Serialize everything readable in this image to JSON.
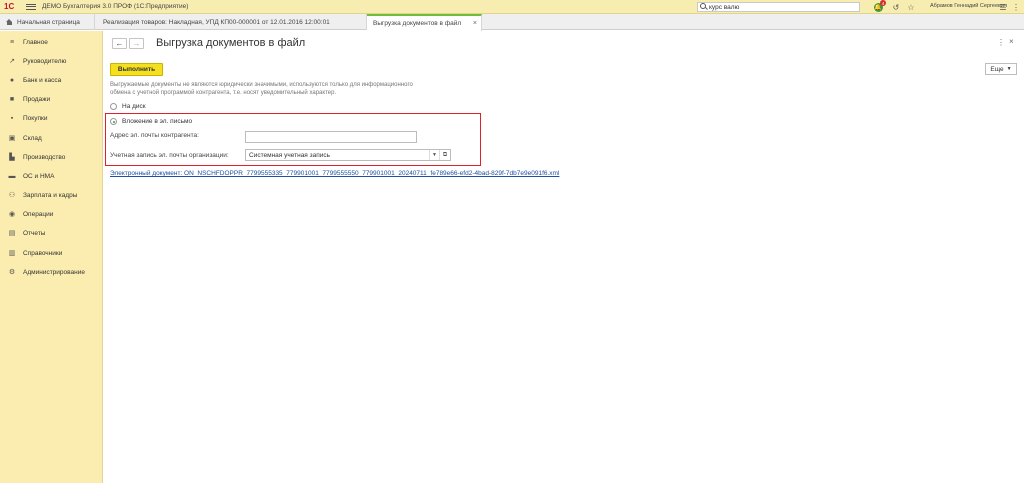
{
  "titlebar": {
    "logo": "1С",
    "app_title": "ДЕМО Бухгалтерия 3.0 ПРОФ  (1С:Предприятие)",
    "search_value": "курс валю",
    "notification_count": "4",
    "user_name": "Абрамов Геннадий Сергеевич"
  },
  "tabs": [
    {
      "label": "Начальная страница"
    },
    {
      "label": "Реализация товаров: Накладная, УПД КП00-000001 от 12.01.2016 12:00:01"
    },
    {
      "label": "Выгрузка документов в файл"
    }
  ],
  "sidebar": {
    "items": [
      {
        "label": "Главное",
        "icon": "menu-icon"
      },
      {
        "label": "Руководителю",
        "icon": "trend-icon"
      },
      {
        "label": "Банк и касса",
        "icon": "coin-icon"
      },
      {
        "label": "Продажи",
        "icon": "bag-icon"
      },
      {
        "label": "Покупки",
        "icon": "cart-icon"
      },
      {
        "label": "Склад",
        "icon": "box-icon"
      },
      {
        "label": "Производство",
        "icon": "factory-icon"
      },
      {
        "label": "ОС и НМА",
        "icon": "car-icon"
      },
      {
        "label": "Зарплата и кадры",
        "icon": "people-icon"
      },
      {
        "label": "Операции",
        "icon": "ops-icon"
      },
      {
        "label": "Отчеты",
        "icon": "report-icon"
      },
      {
        "label": "Справочники",
        "icon": "book-icon"
      },
      {
        "label": "Администрирование",
        "icon": "gear-icon"
      }
    ]
  },
  "main": {
    "title": "Выгрузка документов в файл",
    "execute_label": "Выполнить",
    "more_label": "Еще",
    "info_text": "Выгружаемые документы не являются юридически значимыми, используются только для информационного обмена с учетной программой контрагента, т.е. носят уведомительный характер.",
    "radio_disk": "На диск",
    "radio_email": "Вложение в эл. письмо",
    "email_label": "Адрес эл. почты контрагента:",
    "email_value": "",
    "account_label": "Учетная запись эл. почты организации:",
    "account_value": "Системная учетная запись",
    "doc_link": "Электронный документ: ON_NSCHFDOPPR_7799555335_779901001_7799555550_779901001_20240711_fe789e66-efd2-4bad-829f-7db7e9e091f6.xml"
  }
}
